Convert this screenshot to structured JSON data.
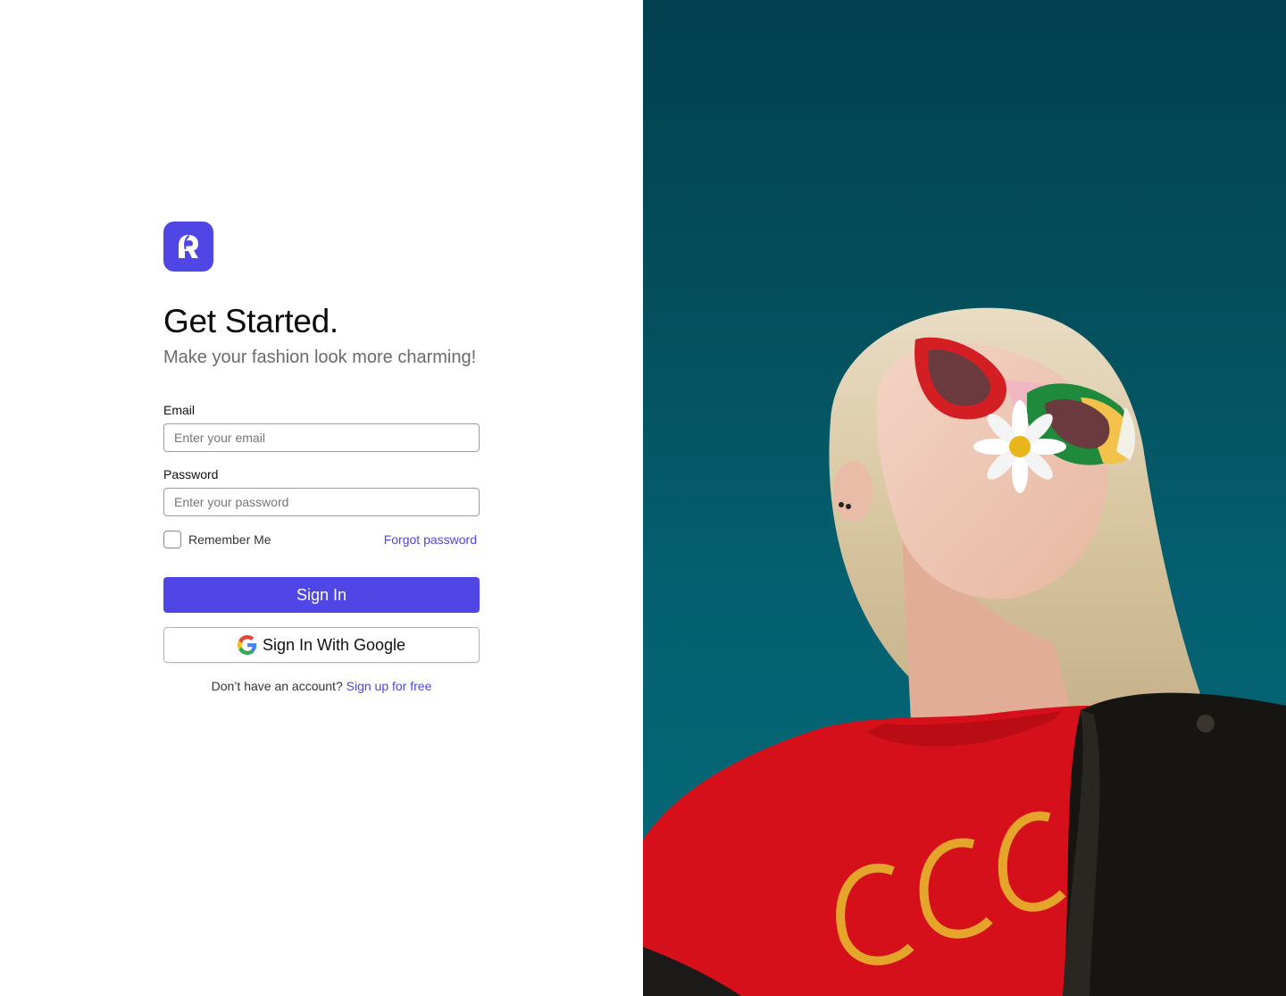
{
  "brand": {
    "accent_color": "#4f46e5",
    "logo_icon": "app-logo-icon"
  },
  "heading": {
    "title": "Get Started.",
    "subtitle": "Make your fashion look more charming!"
  },
  "form": {
    "email_label": "Email",
    "email_placeholder": "Enter your email",
    "email_value": "",
    "password_label": "Password",
    "password_placeholder": "Enter your password",
    "password_value": "",
    "remember_label": "Remember Me",
    "remember_checked": false,
    "forgot_label": "Forgot password",
    "signin_label": "Sign In",
    "google_label": "Sign In With Google",
    "google_icon": "google-icon"
  },
  "footer": {
    "prompt": "Don’t have an account?",
    "signup_label": "Sign up for free"
  },
  "hero": {
    "image": "fashion-photo",
    "background_color": "#045866"
  }
}
